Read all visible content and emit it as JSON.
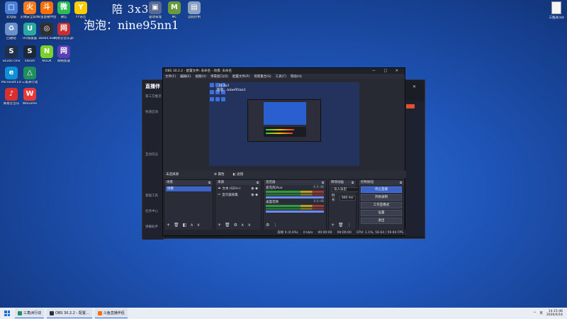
{
  "desktop": {
    "overlay_title": "陪 3x3",
    "overlay_id": "泡泡：nine95nn1",
    "icons": [
      {
        "label": "此电脑",
        "color": "#4a7fd8",
        "glyph": "□"
      },
      {
        "label": "火绒安全软件",
        "color": "#ff7a1a",
        "glyph": "火"
      },
      {
        "label": "斗鱼直播伴侣",
        "color": "#ff6f00",
        "glyph": "斗"
      },
      {
        "label": "微信",
        "color": "#2dbb55",
        "glyph": "微"
      },
      {
        "label": "YY语音",
        "color": "#ffcc00",
        "glyph": "Y"
      },
      {
        "label": "回收站",
        "color": "#6a90c9",
        "glyph": "♻"
      },
      {
        "label": "UU加速器",
        "color": "#2aa8a0",
        "glyph": "U"
      },
      {
        "label": "obs64.exe",
        "color": "#303030",
        "glyph": "◎"
      },
      {
        "label": "网易云音乐游戏平台",
        "color": "#c62f2f",
        "glyph": "网"
      },
      {
        "label": "Studio One",
        "color": "#203048",
        "glyph": "S"
      },
      {
        "label": "Steam",
        "color": "#1b2838",
        "glyph": "S"
      },
      {
        "label": "NODK",
        "color": "#7cd128",
        "glyph": "N"
      },
      {
        "label": "网络加速",
        "color": "#5c3fb2",
        "glyph": "网"
      },
      {
        "label": "Microsoft Edge",
        "color": "#0f8fd6",
        "glyph": "e"
      },
      {
        "label": "三角洲行动",
        "color": "#1f8f5c",
        "glyph": "△"
      },
      {
        "label": "网易云音乐",
        "color": "#d92f2f",
        "glyph": "♪"
      },
      {
        "label": "WeGame",
        "color": "#e63a3a",
        "glyph": "W"
      },
      {
        "label": "MC",
        "color": "#6a9a3a",
        "glyph": "M"
      },
      {
        "label": "远程控制",
        "color": "#8ca0c0",
        "glyph": "▤"
      },
      {
        "label": "驱动管理",
        "color": "#5a6a90",
        "glyph": "▣"
      }
    ],
    "right_file_label": "三角洲.txt"
  },
  "bg_app": {
    "brand": "直播伴",
    "side_items": [
      "第三方推流",
      "快速启动",
      "互动玩法",
      "基础工具",
      "任务中心",
      "弹幕助手"
    ]
  },
  "obs": {
    "title": "OBS 30.2.2 - 配置文件: 未命名 - 场景: 未命名",
    "menu": [
      "文件(F)",
      "编辑(E)",
      "视图(V)",
      "停靠窗口(D)",
      "配置文件(P)",
      "场景集合(S)",
      "工具(T)",
      "帮助(H)"
    ],
    "scene_bar": {
      "selected": "未选择源",
      "props_label": "属性",
      "filters_label": "滤镜"
    },
    "docks": {
      "scenes": {
        "title": "场景",
        "items": [
          "场景"
        ]
      },
      "sources": {
        "title": "来源",
        "items": [
          {
            "name": "文本 (GDI+)",
            "icon": "text"
          },
          {
            "name": "显示器采集",
            "icon": "monitor"
          }
        ]
      },
      "mixer": {
        "title": "混音器",
        "channels": [
          {
            "name": "麦克风/Aux",
            "db": "-0.0 dB"
          },
          {
            "name": "桌面音频",
            "db": "0.0 dB"
          }
        ]
      },
      "transitions": {
        "title": "转场动画",
        "type": "淡入淡出",
        "duration_label": "时长",
        "duration": "300 ms"
      },
      "controls": {
        "title": "控制按钮",
        "buttons": [
          "停止直播",
          "开始录制",
          "工作室模式",
          "设置",
          "退出"
        ]
      }
    },
    "status": {
      "dropped": "丢帧 0 (0.0%)",
      "bitrate": "0 kb/s",
      "live_time": "00:00:00",
      "rec_time": "00:00:00",
      "cpu": "CPU: 1.1%, 56.64 / 59.94 FPS"
    }
  },
  "taskbar": {
    "apps": [
      {
        "label": "三角洲行动",
        "color": "#1f8f5c"
      },
      {
        "label": "OBS 30.2.2 - 配置...",
        "color": "#303030"
      },
      {
        "label": "斗鱼直播伴侣",
        "color": "#ff6f00"
      }
    ],
    "tray": [
      "^",
      "英"
    ],
    "time": "14:15:46",
    "date": "2026/4/16"
  }
}
